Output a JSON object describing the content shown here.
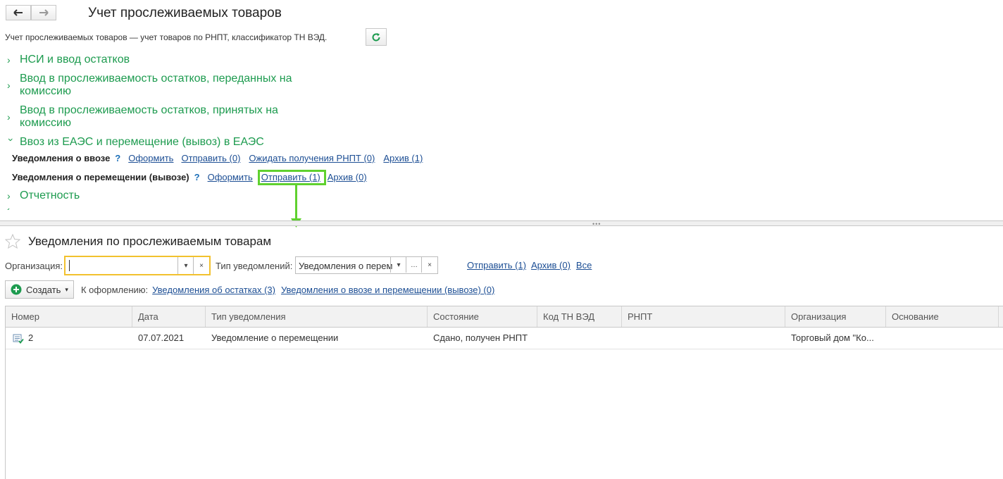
{
  "top": {
    "title": "Учет прослеживаемых товаров",
    "description": "Учет прослеживаемых товаров — учет товаров по РНПТ, классификатор ТН ВЭД.",
    "sections": [
      {
        "label_1": "НСИ и ввод остатков",
        "label_2": ""
      },
      {
        "label_1": "Ввод в прослеживаемость остатков, переданных на",
        "label_2": "комиссию"
      },
      {
        "label_1": "Ввод в прослеживаемость остатков, принятых на",
        "label_2": "комиссию"
      },
      {
        "label_1": "Ввоз из ЕАЭС и перемещение (вывоз) в ЕАЭС",
        "label_2": ""
      },
      {
        "label_1": "Отчетность",
        "label_2": ""
      }
    ],
    "import_row": {
      "label": "Уведомления о ввозе",
      "help": "?",
      "create": "Оформить",
      "send": "Отправить (0)",
      "await": "Ожидать получения РНПТ (0)",
      "archive": "Архив (1)"
    },
    "move_row": {
      "label": "Уведомления о перемещении (вывозе)",
      "help": "?",
      "create": "Оформить",
      "send": "Отправить (1)",
      "archive": "Архив (0)"
    }
  },
  "bottom": {
    "title": "Уведомления по прослеживаемым товарам",
    "org_label": "Организация:",
    "org_value": "",
    "type_label": "Тип уведомлений:",
    "type_value": "Уведомления о перем",
    "filter_links": {
      "send": "Отправить (1)",
      "archive": "Архив (0)",
      "all": "Все"
    },
    "create_button": "Создать",
    "todo_label": "К оформлению:",
    "todo_links": [
      "Уведомления об остатках (3)",
      "Уведомления о ввозе и перемещении (вывозе) (0)"
    ],
    "columns": [
      "Номер",
      "Дата",
      "Тип уведомления",
      "Состояние",
      "Код ТН ВЭД",
      "РНПТ",
      "Организация",
      "Основание"
    ],
    "rows": [
      {
        "number": "2",
        "date": "07.07.2021",
        "type": "Уведомление о перемещении",
        "state": "Сдано, получен РНПТ",
        "code": "",
        "rnpt": "",
        "org": "Торговый дом \"Ко...",
        "basis": ""
      }
    ]
  },
  "colors": {
    "accent_green": "#1d9b4f",
    "highlight_green": "#5fd12f",
    "link_blue": "#1c4e94",
    "focus_yellow": "#f2c12e"
  }
}
